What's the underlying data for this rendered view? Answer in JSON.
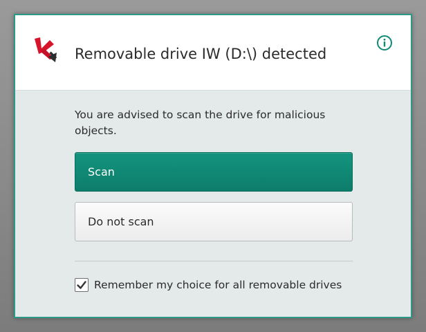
{
  "header": {
    "title": "Removable drive IW (D:\\) detected",
    "logo_icon": "kaspersky-k-logo-icon",
    "info_icon": "info-circle-icon"
  },
  "body": {
    "message": "You are advised to scan the drive for malicious objects.",
    "scan_label": "Scan",
    "do_not_scan_label": "Do not scan",
    "remember_label": "Remember my choice for all removable drives",
    "remember_checked": true
  },
  "colors": {
    "accent": "#0f8a75",
    "window_border": "#2a9a86",
    "logo_red": "#d6152a",
    "body_bg": "#e4e9ea"
  }
}
